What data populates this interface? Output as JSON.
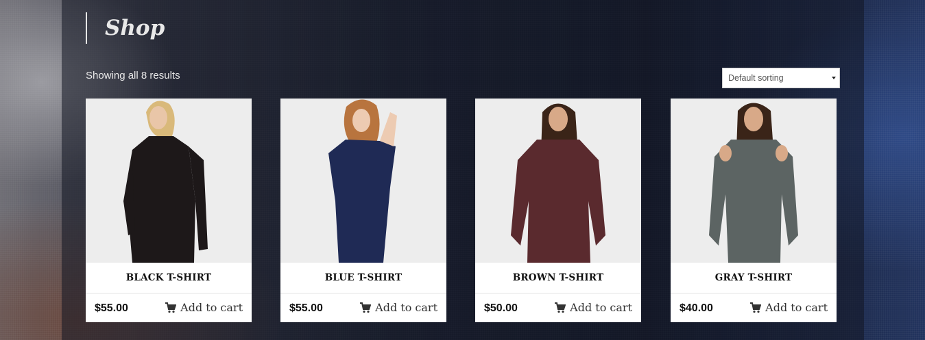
{
  "page": {
    "title": "Shop"
  },
  "toolbar": {
    "results_count": "Showing all 8 results",
    "sort_value": "Default sorting"
  },
  "products": [
    {
      "name": "BLACK T-SHIRT",
      "price": "$55.00",
      "cart_label": "Add to cart",
      "garment_color": "#1d1819"
    },
    {
      "name": "BLUE T-SHIRT",
      "price": "$55.00",
      "cart_label": "Add to cart",
      "garment_color": "#1f2a55"
    },
    {
      "name": "BROWN T-SHIRT",
      "price": "$50.00",
      "cart_label": "Add to cart",
      "garment_color": "#5a2a2e"
    },
    {
      "name": "GRAY T-SHIRT",
      "price": "$40.00",
      "cart_label": "Add to cart",
      "garment_color": "#5c6463"
    }
  ]
}
